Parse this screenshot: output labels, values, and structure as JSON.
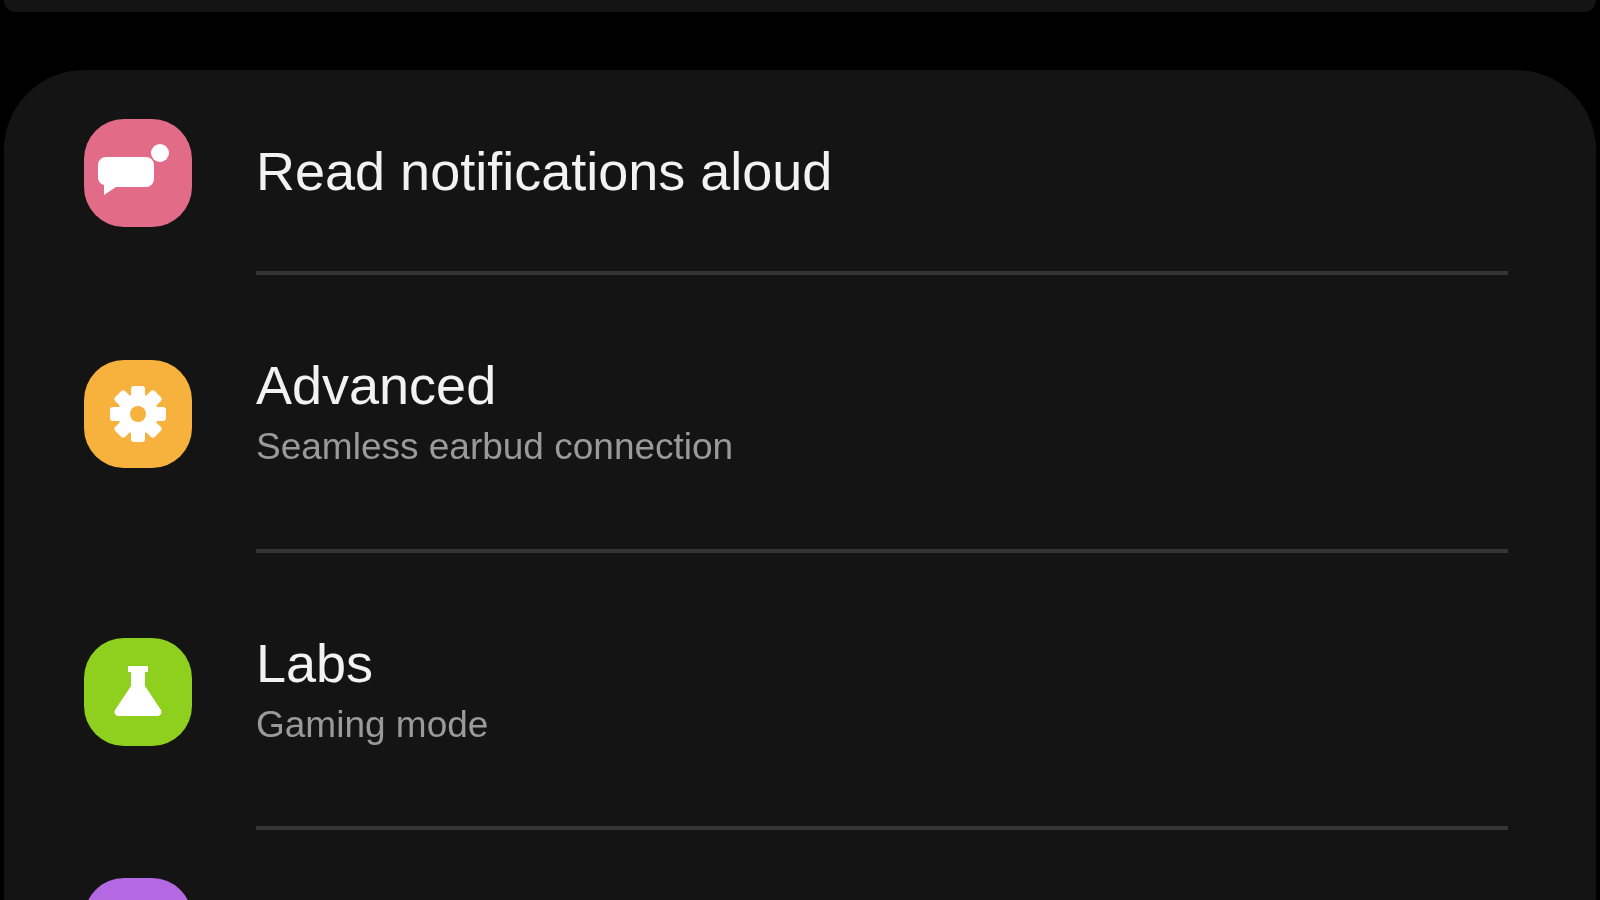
{
  "items": [
    {
      "kind": "speech",
      "color": "#e26b87",
      "title": "Read notifications aloud"
    },
    {
      "kind": "gear",
      "color": "#f7b23e",
      "title": "Advanced",
      "subtitle": "Seamless earbud connection"
    },
    {
      "kind": "flask",
      "color": "#8fcf1e",
      "title": "Labs",
      "subtitle": "Gaming mode"
    },
    {
      "kind": "blank",
      "color": "#b468e2"
    }
  ]
}
